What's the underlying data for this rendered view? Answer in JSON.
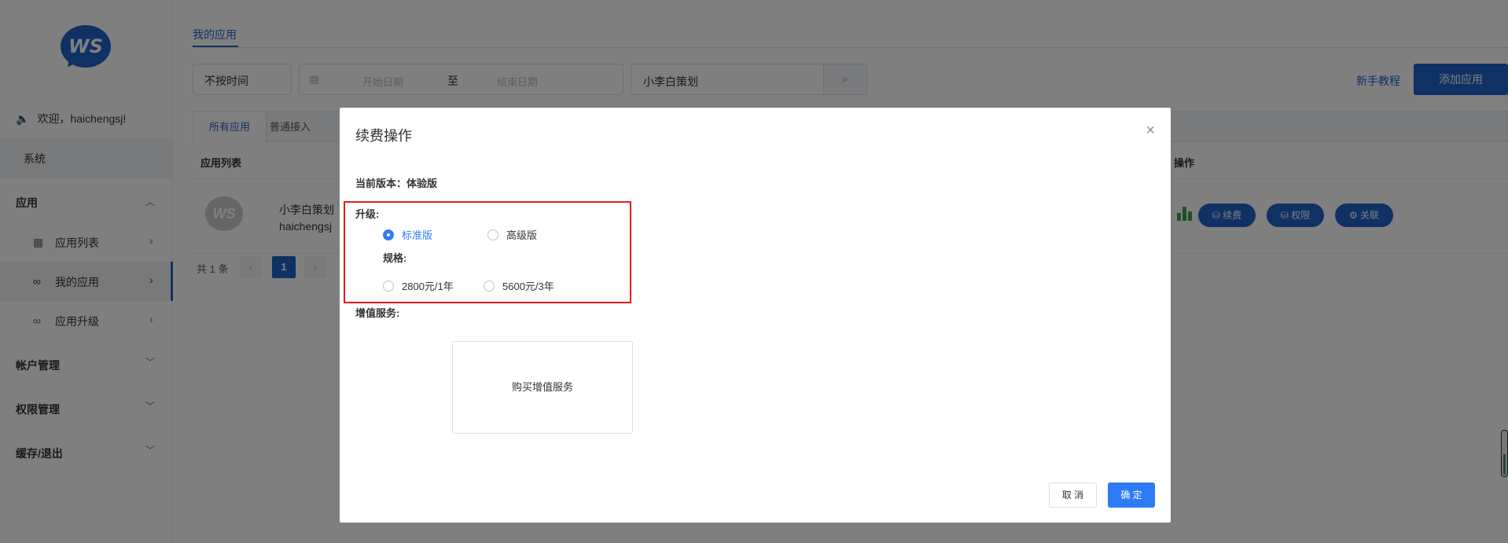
{
  "sidebar": {
    "logo_text": "WS",
    "welcome": "欢迎，haichengsj!",
    "system": "系统",
    "groups": [
      {
        "label": "应用"
      },
      {
        "label": "帐户管理"
      },
      {
        "label": "权限管理"
      },
      {
        "label": "缓存/退出"
      }
    ],
    "items": [
      {
        "label": "应用列表",
        "icon": "grid-icon"
      },
      {
        "label": "我的应用",
        "icon": "link-icon"
      },
      {
        "label": "应用升级",
        "icon": "link-icon"
      }
    ]
  },
  "main": {
    "top_tab": "我的应用",
    "filter": {
      "time_select": "不按时间",
      "start_placeholder": "开始日期",
      "separator": "至",
      "end_placeholder": "结束日期",
      "search_value": "小李白策划"
    },
    "tutorial_link": "新手教程",
    "add_button": "添加应用",
    "sub_tabs": [
      "所有应用",
      "普通接入"
    ],
    "table": {
      "col_list": "应用列表",
      "col_ops": "操作",
      "row": {
        "logo": "WS",
        "name": "小李白策划",
        "user": "haichengsj",
        "actions": [
          "续费",
          "权限",
          "关联"
        ]
      }
    },
    "pagination": {
      "total": "共 1 条",
      "prev": "‹",
      "page": "1",
      "next": "›"
    }
  },
  "modal": {
    "title": "续费操作",
    "close": "×",
    "current_version": "当前版本：体验版",
    "upgrade_label": "升级:",
    "upgrade_options": [
      {
        "label": "标准版",
        "checked": true
      },
      {
        "label": "高级版",
        "checked": false
      }
    ],
    "spec_label": "规格:",
    "spec_options": [
      {
        "label": "2800元/1年",
        "checked": false
      },
      {
        "label": "5600元/3年",
        "checked": false
      }
    ],
    "addon_label": "增值服务:",
    "addon_card": "购买增值服务",
    "cancel": "取 消",
    "ok": "确 定"
  },
  "colors": {
    "primary": "#1f63c9",
    "radio_blue": "#2f7bf5",
    "highlight": "#e41b1b",
    "chart_green": "#3aa34a"
  }
}
